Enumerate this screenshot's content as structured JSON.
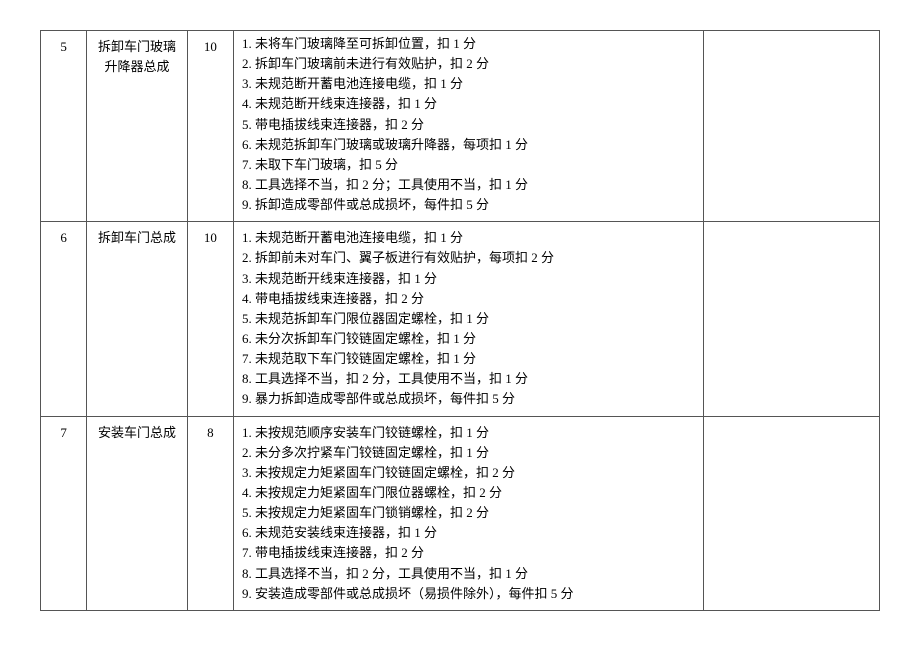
{
  "rows": [
    {
      "seq": "5",
      "name": "拆卸车门玻璃升降器总成",
      "score": "10",
      "criteria": [
        "1. 未将车门玻璃降至可拆卸位置，扣 1 分",
        "2. 拆卸车门玻璃前未进行有效贴护，扣 2 分",
        "3. 未规范断开蓄电池连接电缆，扣 1 分",
        "4. 未规范断开线束连接器，扣 1 分",
        "5. 带电插拔线束连接器，扣 2 分",
        "6. 未规范拆卸车门玻璃或玻璃升降器，每项扣 1 分",
        "7. 未取下车门玻璃，扣 5 分",
        "8. 工具选择不当，扣 2 分；工具使用不当，扣 1 分",
        "9. 拆卸造成零部件或总成损坏，每件扣 5 分"
      ]
    },
    {
      "seq": "6",
      "name": "拆卸车门总成",
      "score": "10",
      "criteria": [
        "1. 未规范断开蓄电池连接电缆，扣 1 分",
        "2. 拆卸前未对车门、翼子板进行有效贴护，每项扣 2 分",
        "3. 未规范断开线束连接器，扣 1 分",
        "4. 带电插拔线束连接器，扣 2 分",
        "5. 未规范拆卸车门限位器固定螺栓，扣 1 分",
        "6. 未分次拆卸车门铰链固定螺栓，扣 1 分",
        "7. 未规范取下车门铰链固定螺栓，扣 1 分",
        "8. 工具选择不当，扣 2 分，工具使用不当，扣 1 分",
        "9. 暴力拆卸造成零部件或总成损坏，每件扣 5 分"
      ]
    },
    {
      "seq": "7",
      "name": "安装车门总成",
      "score": "8",
      "criteria": [
        "1. 未按规范顺序安装车门铰链螺栓，扣 1 分",
        "2. 未分多次拧紧车门铰链固定螺栓，扣 1 分",
        "3. 未按规定力矩紧固车门铰链固定螺栓，扣 2 分",
        "4. 未按规定力矩紧固车门限位器螺栓，扣 2 分",
        "5. 未按规定力矩紧固车门锁销螺栓，扣 2 分",
        "6. 未规范安装线束连接器，扣 1 分",
        "7. 带电插拔线束连接器，扣 2 分",
        "8. 工具选择不当，扣 2 分，工具使用不当，扣 1 分",
        "9. 安装造成零部件或总成损坏（易损件除外），每件扣 5 分"
      ]
    }
  ]
}
